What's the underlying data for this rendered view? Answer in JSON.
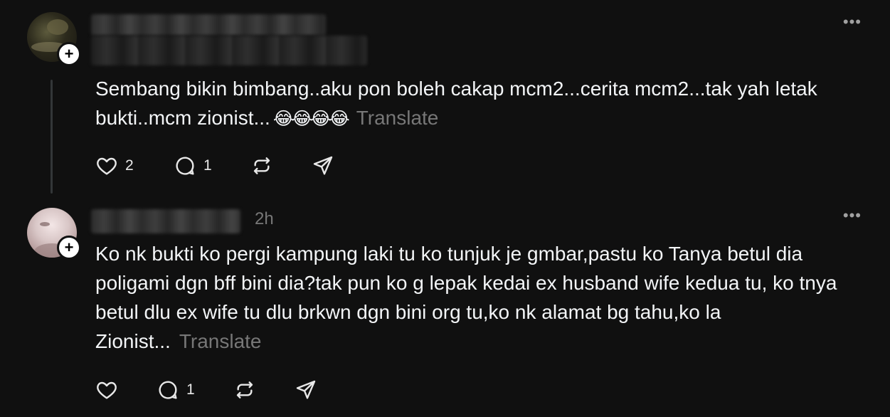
{
  "posts": [
    {
      "timestamp": "",
      "body": "Sembang bikin bimbang..aku pon boleh cakap mcm2...cerita mcm2...tak yah letak bukti..mcm zionist...",
      "emoji": "😂😂😂😂",
      "translate_label": "Translate",
      "follow_symbol": "+",
      "more_symbol": "•••",
      "likes": "2",
      "replies": "1",
      "reposts": "",
      "icons": [
        "heart-icon",
        "comment-icon",
        "repost-icon",
        "share-icon"
      ]
    },
    {
      "timestamp": "2h",
      "body": "Ko nk bukti ko pergi kampung laki tu ko tunjuk je gmbar,pastu ko Tanya betul dia poligami dgn bff bini dia?tak pun ko g lepak kedai ex husband wife kedua tu, ko tnya betul dlu ex wife tu dlu brkwn dgn bini org tu,ko nk alamat bg tahu,ko la Zionist...",
      "translate_label": "Translate",
      "follow_symbol": "+",
      "more_symbol": "•••",
      "likes": "",
      "replies": "1",
      "reposts": "",
      "icons": [
        "heart-icon",
        "comment-icon",
        "repost-icon",
        "share-icon"
      ]
    }
  ],
  "colors": {
    "background": "#101010",
    "text": "#f3f5f7",
    "muted": "#777777",
    "thread_line": "#333638"
  }
}
